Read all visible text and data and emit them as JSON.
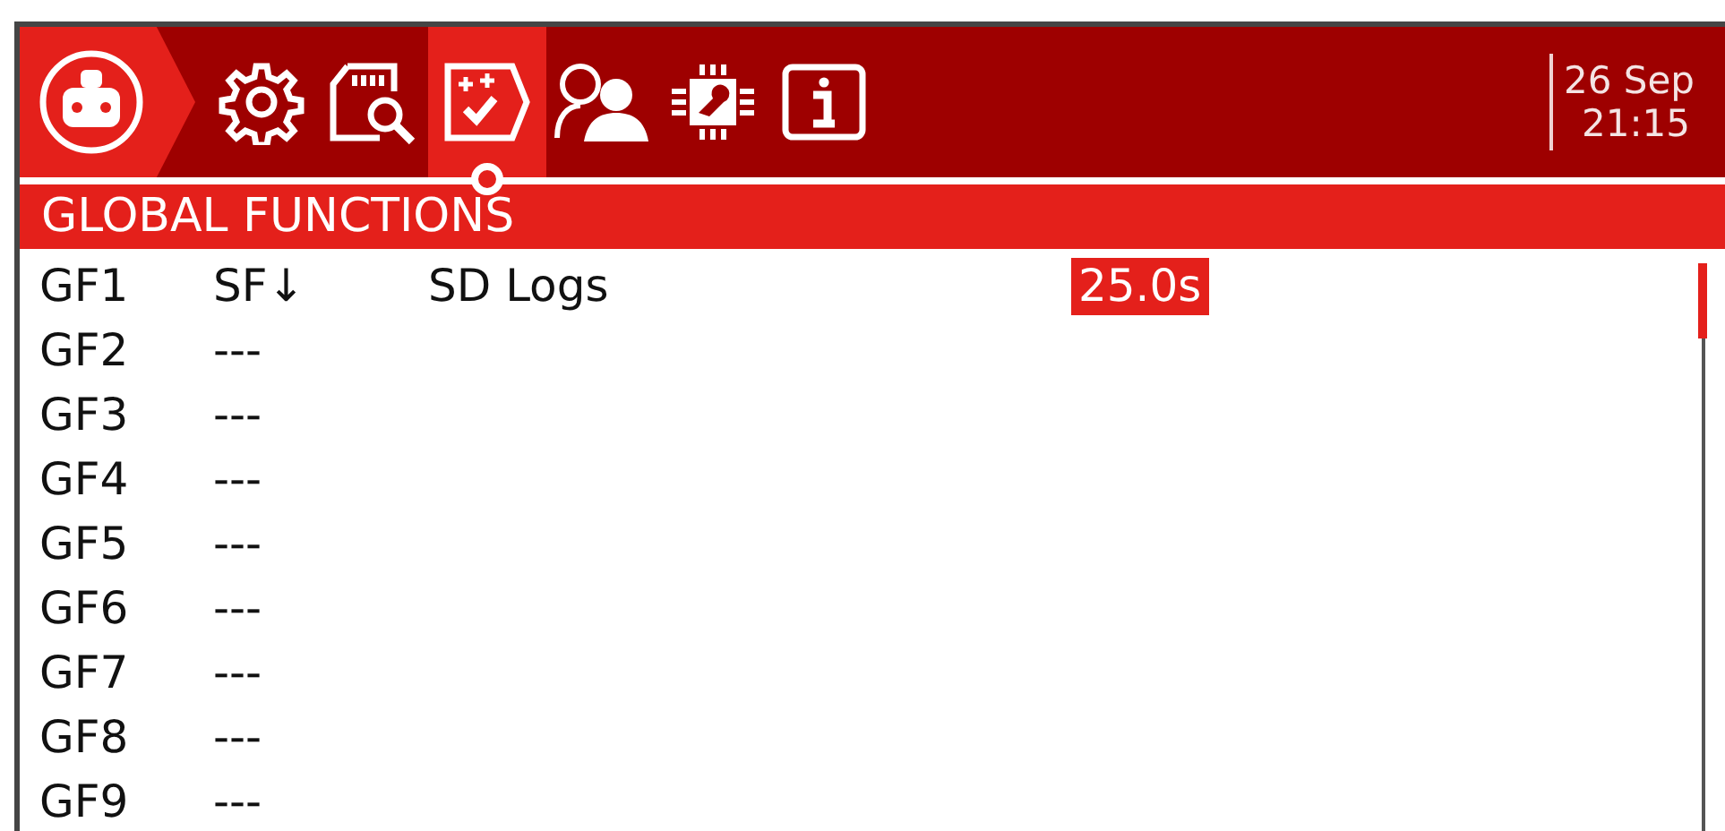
{
  "header": {
    "tabs": [
      {
        "kind": "settings",
        "selected": false
      },
      {
        "kind": "sdcard",
        "selected": false
      },
      {
        "kind": "checklist",
        "selected": true
      },
      {
        "kind": "users",
        "selected": false
      },
      {
        "kind": "hardware",
        "selected": false
      },
      {
        "kind": "info",
        "selected": false
      }
    ],
    "date": "26 Sep",
    "time": "21:15"
  },
  "title": "GLOBAL FUNCTIONS",
  "rows": [
    {
      "label": "GF1",
      "switch": "SF↓",
      "function": "SD Logs",
      "value": {
        "text": "25.0s",
        "selected": true
      }
    },
    {
      "label": "GF2",
      "switch": "---"
    },
    {
      "label": "GF3",
      "switch": "---"
    },
    {
      "label": "GF4",
      "switch": "---"
    },
    {
      "label": "GF5",
      "switch": "---"
    },
    {
      "label": "GF6",
      "switch": "---"
    },
    {
      "label": "GF7",
      "switch": "---"
    },
    {
      "label": "GF8",
      "switch": "---"
    },
    {
      "label": "GF9",
      "switch": "---"
    }
  ]
}
